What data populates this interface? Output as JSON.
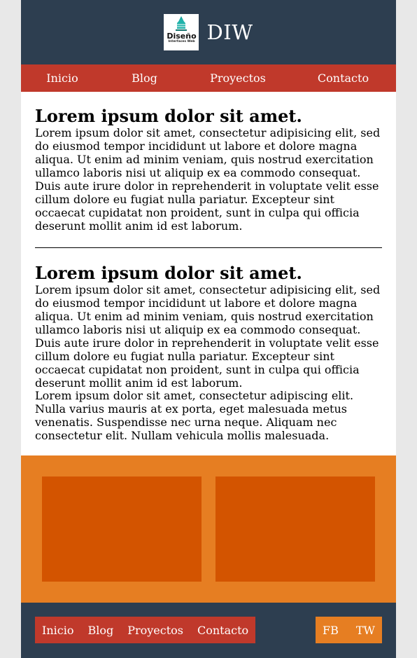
{
  "header": {
    "logo": {
      "icon": "building-logo-icon",
      "main_text": "Diseño",
      "sub_text": "Interfaces Web"
    },
    "title": "DIW"
  },
  "nav": {
    "items": [
      "Inicio",
      "Blog",
      "Proyectos",
      "Contacto"
    ]
  },
  "articles": [
    {
      "title": "Lorem ipsum dolor sit amet.",
      "paragraphs": [
        "Lorem ipsum dolor sit amet, consectetur adipisicing elit, sed do eiusmod tempor incididunt ut labore et dolore magna aliqua. Ut enim ad minim veniam, quis nostrud exercitation ullamco laboris nisi ut aliquip ex ea commodo consequat. Duis aute irure dolor in reprehenderit in voluptate velit esse cillum dolore eu fugiat nulla pariatur. Excepteur sint occaecat cupidatat non proident, sunt in culpa qui officia deserunt mollit anim id est laborum."
      ]
    },
    {
      "title": "Lorem ipsum dolor sit amet.",
      "paragraphs": [
        "Lorem ipsum dolor sit amet, consectetur adipisicing elit, sed do eiusmod tempor incididunt ut labore et dolore magna aliqua. Ut enim ad minim veniam, quis nostrud exercitation ullamco laboris nisi ut aliquip ex ea commodo consequat. Duis aute irure dolor in reprehenderit in voluptate velit esse cillum dolore eu fugiat nulla pariatur. Excepteur sint occaecat cupidatat non proident, sunt in culpa qui officia deserunt mollit anim id est laborum.",
        "Lorem ipsum dolor sit amet, consectetur adipiscing elit. Nulla varius mauris at ex porta, eget malesuada metus venenatis. Suspendisse nec urna neque. Aliquam nec consectetur elit. Nullam vehicula mollis malesuada."
      ]
    }
  ],
  "footer": {
    "nav": [
      "Inicio",
      "Blog",
      "Proyectos",
      "Contacto"
    ],
    "social": [
      "FB",
      "TW"
    ]
  },
  "colors": {
    "header_bg": "#2d3e50",
    "nav_bg": "#c0392b",
    "features_bg": "#e67e22",
    "feature_box": "#d35400",
    "page_bg": "#e8e8e8"
  }
}
